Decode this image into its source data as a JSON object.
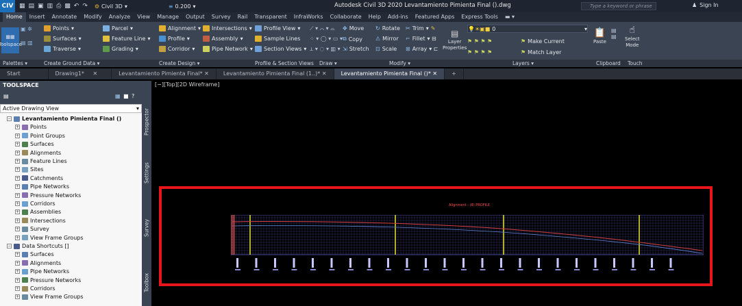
{
  "app": {
    "button_label": "CIV",
    "workspace": "Civil 3D",
    "lineweight": "0.200",
    "title": "Autodesk Civil 3D 2020   Levantamiento Pimienta Final ().dwg",
    "search_placeholder": "Type a keyword or phrase",
    "sign_in": "Sign In"
  },
  "menu_tabs": [
    "Home",
    "Insert",
    "Annotate",
    "Modify",
    "Analyze",
    "View",
    "Manage",
    "Output",
    "Survey",
    "Rail",
    "Transparent",
    "InfraWorks",
    "Collaborate",
    "Help",
    "Add-ins",
    "Featured Apps",
    "Express Tools"
  ],
  "ribbon": {
    "toolspace": "Toolspace",
    "points": "Points",
    "surfaces": "Surfaces",
    "traverse": "Traverse",
    "parcel": "Parcel",
    "feature_line": "Feature Line",
    "grading": "Grading",
    "alignment": "Alignment",
    "profile": "Profile",
    "corridor": "Corridor",
    "intersections": "Intersections",
    "assembly": "Assembly",
    "pipe_network": "Pipe Network",
    "profile_view": "Profile View",
    "sample_lines": "Sample Lines",
    "section_views": "Section Views",
    "move": "Move",
    "copy": "Copy",
    "stretch": "Stretch",
    "rotate": "Rotate",
    "mirror": "Mirror",
    "scale": "Scale",
    "trim": "Trim",
    "fillet": "Fillet",
    "array": "Array",
    "layer_properties_1": "Layer",
    "layer_properties_2": "Properties",
    "layer_value": "0",
    "make_current": "Make Current",
    "match_layer": "Match Layer",
    "paste": "Paste",
    "select_mode_1": "Select",
    "select_mode_2": "Mode"
  },
  "panels": [
    "Palettes",
    "Create Ground Data",
    "Create Design",
    "Profile & Section Views",
    "Draw",
    "Modify",
    "Layers",
    "Clipboard",
    "Touch"
  ],
  "doc_tabs": [
    {
      "label": "Start"
    },
    {
      "label": "Drawing1*"
    },
    {
      "label": "Levantamiento Pimienta Final*"
    },
    {
      "label": "Levantamiento Pimienta Final (1..)*"
    },
    {
      "label": "Levantamiento Pimienta Final ()*"
    }
  ],
  "toolspace": {
    "header": "TOOLSPACE",
    "view_select": "Active Drawing View",
    "tree": [
      {
        "label": "Levantamiento Pimienta Final ()",
        "level": 0,
        "bold": true
      },
      {
        "label": "Points",
        "level": 1
      },
      {
        "label": "Point Groups",
        "level": 1
      },
      {
        "label": "Surfaces",
        "level": 1
      },
      {
        "label": "Alignments",
        "level": 1
      },
      {
        "label": "Feature Lines",
        "level": 1
      },
      {
        "label": "Sites",
        "level": 1
      },
      {
        "label": "Catchments",
        "level": 1
      },
      {
        "label": "Pipe Networks",
        "level": 1
      },
      {
        "label": "Pressure Networks",
        "level": 1
      },
      {
        "label": "Corridors",
        "level": 1
      },
      {
        "label": "Assemblies",
        "level": 1
      },
      {
        "label": "Intersections",
        "level": 1
      },
      {
        "label": "Survey",
        "level": 1
      },
      {
        "label": "View Frame Groups",
        "level": 1
      },
      {
        "label": "Data Shortcuts []",
        "level": 0
      },
      {
        "label": "Surfaces",
        "level": 1
      },
      {
        "label": "Alignments",
        "level": 1
      },
      {
        "label": "Pipe Networks",
        "level": 1
      },
      {
        "label": "Pressure Networks",
        "level": 1
      },
      {
        "label": "Corridors",
        "level": 1
      },
      {
        "label": "View Frame Groups",
        "level": 1
      }
    ],
    "side_tabs": [
      "Prospector",
      "Settings",
      "Survey",
      "Toolbox"
    ]
  },
  "viewport": {
    "label": "[−][Top][2D Wireframe]",
    "profile_title": "Alignment - (8) PROFILE"
  },
  "colors": {
    "highlight_frame": "#e8151b",
    "grid": "#4a4a9a",
    "station_lines": "#e8e830",
    "profile_line": "#d04040"
  }
}
